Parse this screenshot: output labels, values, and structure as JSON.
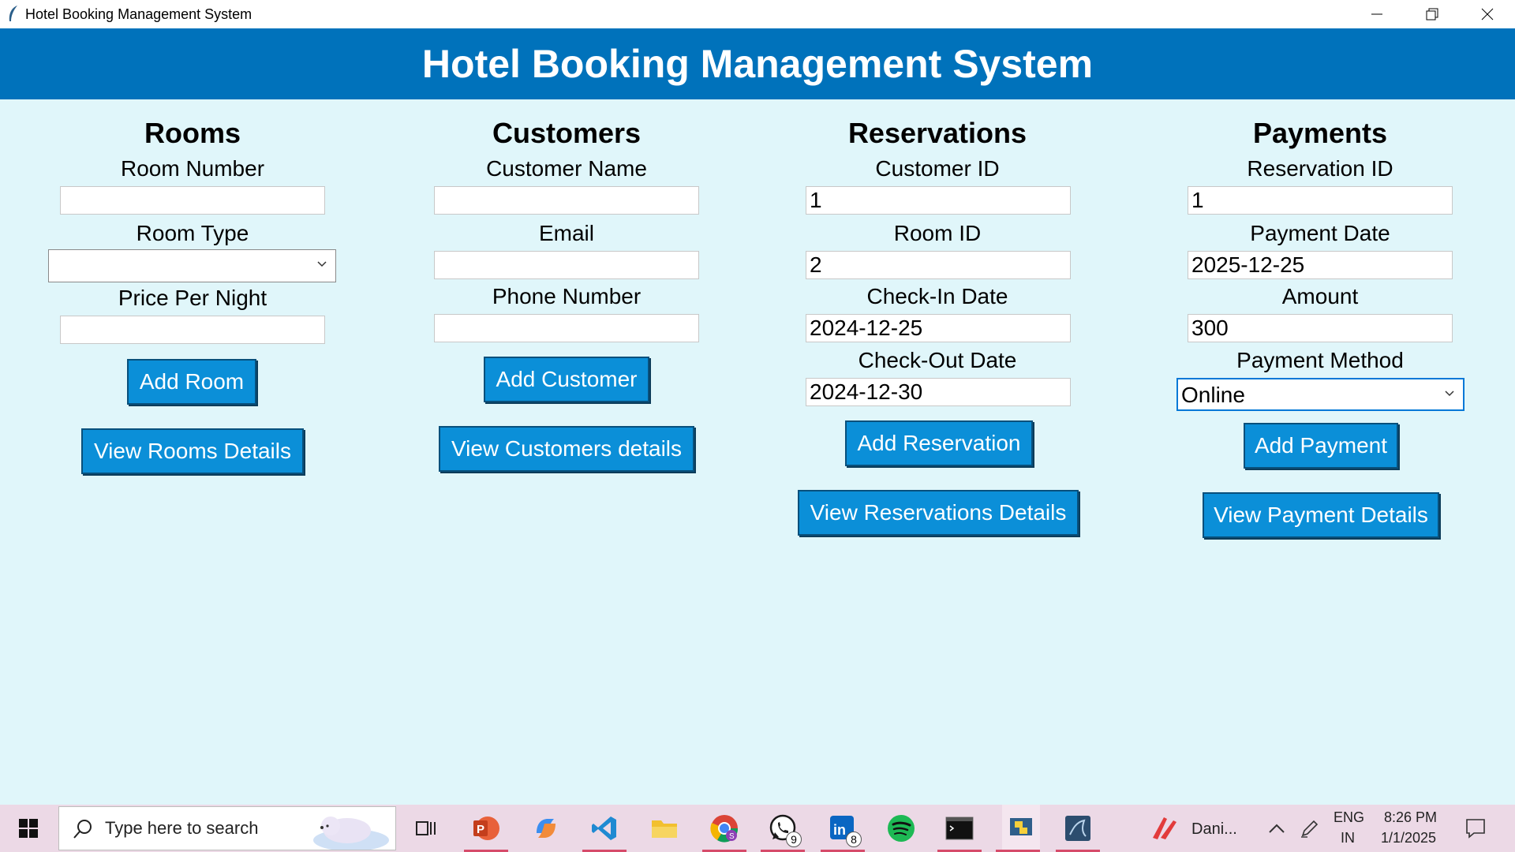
{
  "window": {
    "title": "Hotel Booking Management System"
  },
  "header": {
    "title": "Hotel Booking Management System"
  },
  "rooms": {
    "heading": "Rooms",
    "room_number_label": "Room Number",
    "room_number_value": "",
    "room_type_label": "Room Type",
    "room_type_value": "",
    "price_label": "Price Per Night",
    "price_value": "",
    "add_button": "Add Room",
    "view_button": "View Rooms Details"
  },
  "customers": {
    "heading": "Customers",
    "name_label": "Customer Name",
    "name_value": "",
    "email_label": "Email",
    "email_value": "",
    "phone_label": "Phone Number",
    "phone_value": "",
    "add_button": "Add Customer",
    "view_button": "View Customers details"
  },
  "reservations": {
    "heading": "Reservations",
    "customer_id_label": "Customer ID",
    "customer_id_value": "1",
    "room_id_label": "Room ID",
    "room_id_value": "2",
    "checkin_label": "Check-In Date",
    "checkin_value": "2024-12-25",
    "checkout_label": "Check-Out Date",
    "checkout_value": "2024-12-30",
    "add_button": "Add Reservation",
    "view_button": "View Reservations Details"
  },
  "payments": {
    "heading": "Payments",
    "reservation_id_label": "Reservation ID",
    "reservation_id_value": "1",
    "date_label": "Payment Date",
    "date_value": "2025-12-25",
    "amount_label": "Amount",
    "amount_value": "300",
    "method_label": "Payment Method",
    "method_value": "Online",
    "add_button": "Add Payment",
    "view_button": "View Payment Details"
  },
  "taskbar": {
    "search_placeholder": "Type here to search",
    "whatsapp_badge": "9",
    "linkedin_badge": "8",
    "pinned_app_label": "Dani...",
    "lang_top": "ENG",
    "lang_bottom": "IN",
    "time": "8:26 PM",
    "date": "1/1/2025"
  },
  "colors": {
    "header": "#0072bb",
    "background": "#e0f6fa",
    "button": "#0b8fd8",
    "taskbar": "#ecd9e6"
  }
}
